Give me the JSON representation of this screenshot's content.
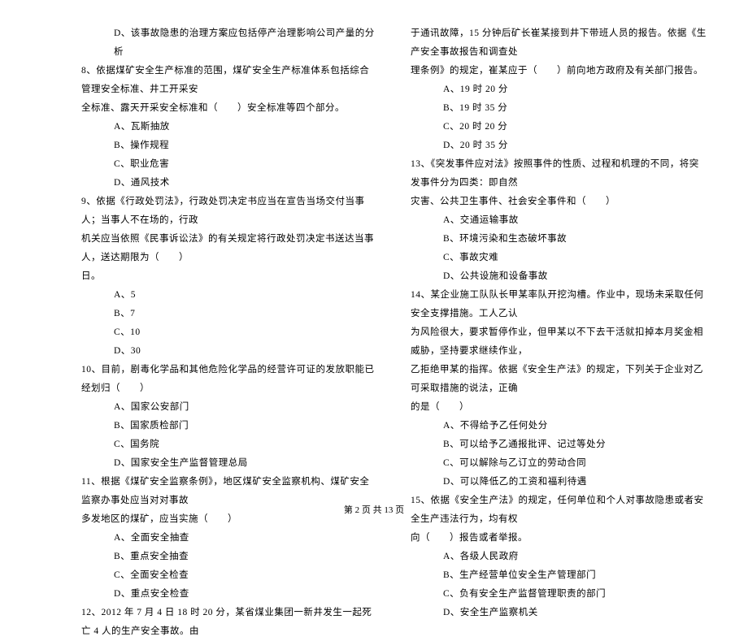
{
  "left": {
    "l1": "D、该事故隐患的治理方案应包括停产治理影响公司产量的分析",
    "l2": "8、依据煤矿安全生产标准的范围，煤矿安全生产标准体系包括综合管理安全标准、井工开采安",
    "l3": "全标准、露天开采安全标准和（　　）安全标准等四个部分。",
    "l4": "A、瓦斯抽放",
    "l5": "B、操作规程",
    "l6": "C、职业危害",
    "l7": "D、通风技术",
    "l8": "9、依据《行政处罚法》，行政处罚决定书应当在宣告当场交付当事人；当事人不在场的，行政",
    "l9": "机关应当依照《民事诉讼法》的有关规定将行政处罚决定书送达当事人，送达期限为（　　）",
    "l10": "日。",
    "l11": "A、5",
    "l12": "B、7",
    "l13": "C、10",
    "l14": "D、30",
    "l15": "10、目前，剧毒化学品和其他危险化学品的经营许可证的发放职能已经划归（　　）",
    "l16": "A、国家公安部门",
    "l17": "B、国家质检部门",
    "l18": "C、国务院",
    "l19": "D、国家安全生产监督管理总局",
    "l20": "11、根据《煤矿安全监察条例》，地区煤矿安全监察机构、煤矿安全监察办事处应当对对事故",
    "l21": "多发地区的煤矿，应当实施（　　）",
    "l22": "A、全面安全抽查",
    "l23": "B、重点安全抽查",
    "l24": "C、全面安全检查",
    "l25": "D、重点安全检查",
    "l26": "12、2012 年 7 月 4 日 18 时 20 分，某省煤业集团一新井发生一起死亡 4 人的生产安全事故。由"
  },
  "right": {
    "r1": "于通讯故障，15 分钟后矿长崔某接到井下带班人员的报告。依据《生产安全事故报告和调查处",
    "r2": "理条例》的规定，崔某应于（　　）前向地方政府及有关部门报告。",
    "r3": "A、19 时 20 分",
    "r4": "B、19 时 35 分",
    "r5": "C、20 时 20 分",
    "r6": "D、20 时 35 分",
    "r7": "13、《突发事件应对法》按照事件的性质、过程和机理的不同，将突发事件分为四类：即自然",
    "r8": "灾害、公共卫生事件、社会安全事件和（　　）",
    "r9": "A、交通运输事故",
    "r10": "B、环境污染和生态破坏事故",
    "r11": "C、事故灾难",
    "r12": "D、公共设施和设备事故",
    "r13": "14、某企业施工队队长甲某率队开挖沟槽。作业中，现场未采取任何安全支撑措施。工人乙认",
    "r14": "为风险很大，要求暂停作业，但甲某以不下去干活就扣掉本月奖金相威胁，坚持要求继续作业，",
    "r15": "乙拒绝甲某的指挥。依据《安全生产法》的规定，下列关于企业对乙可采取措施的说法，正确",
    "r16": "的是（　　）",
    "r17": "A、不得给予乙任何处分",
    "r18": "B、可以给予乙通报批评、记过等处分",
    "r19": "C、可以解除与乙订立的劳动合同",
    "r20": "D、可以降低乙的工资和福利待遇",
    "r21": "15、依据《安全生产法》的规定，任何单位和个人对事故隐患或者安全生产违法行为，均有权",
    "r22": "向（　　）报告或者举报。",
    "r23": "A、各级人民政府",
    "r24": "B、生产经营单位安全生产管理部门",
    "r25": "C、负有安全生产监督管理职责的部门",
    "r26": "D、安全生产监察机关"
  },
  "footer": "第 2 页 共 13 页"
}
